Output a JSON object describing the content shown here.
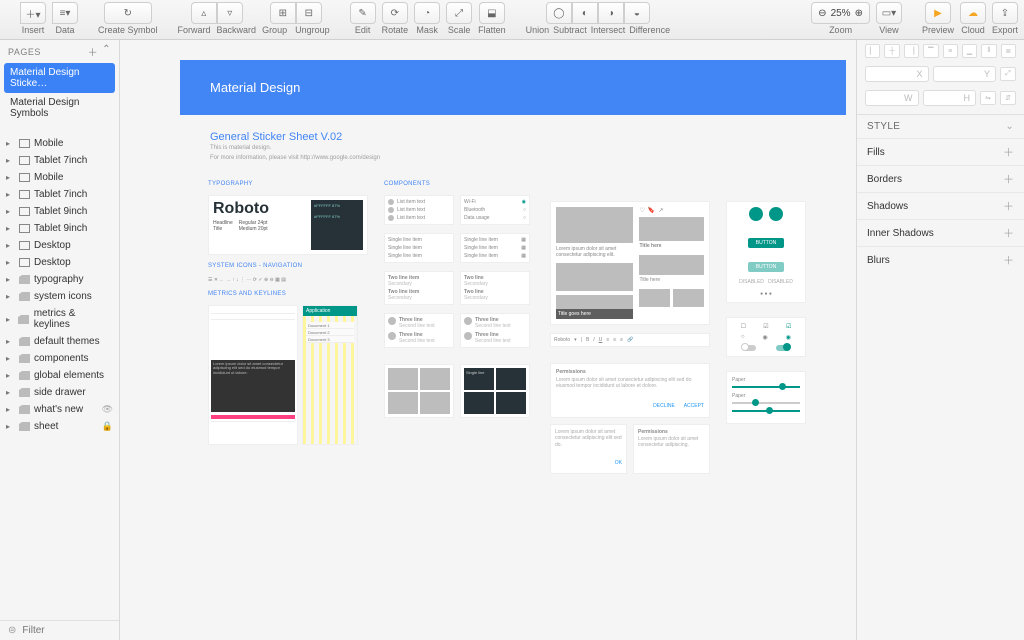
{
  "toolbar": {
    "insert": "Insert",
    "data": "Data",
    "create_symbol": "Create Symbol",
    "forward": "Forward",
    "backward": "Backward",
    "group": "Group",
    "ungroup": "Ungroup",
    "edit": "Edit",
    "rotate": "Rotate",
    "mask": "Mask",
    "scale": "Scale",
    "flatten": "Flatten",
    "union": "Union",
    "subtract": "Subtract",
    "intersect": "Intersect",
    "difference": "Difference",
    "zoom": "Zoom",
    "zoom_value": "25%",
    "view": "View",
    "preview": "Preview",
    "cloud": "Cloud",
    "export": "Export"
  },
  "left": {
    "pages_label": "PAGES",
    "pages": [
      "Material Design Sticke…",
      "Material Design Symbols"
    ],
    "layers": [
      {
        "label": "Mobile",
        "kind": "artboard"
      },
      {
        "label": "Tablet 7inch",
        "kind": "artboard"
      },
      {
        "label": "Mobile",
        "kind": "artboard"
      },
      {
        "label": "Tablet 7inch",
        "kind": "artboard"
      },
      {
        "label": "Tablet 9inch",
        "kind": "artboard"
      },
      {
        "label": "Tablet 9inch",
        "kind": "artboard"
      },
      {
        "label": "Desktop",
        "kind": "artboard"
      },
      {
        "label": "Desktop",
        "kind": "artboard"
      },
      {
        "label": "typography",
        "kind": "folder"
      },
      {
        "label": "system icons",
        "kind": "folder"
      },
      {
        "label": "metrics & keylines",
        "kind": "folder"
      },
      {
        "label": "default themes",
        "kind": "folder"
      },
      {
        "label": "components",
        "kind": "folder"
      },
      {
        "label": "global elements",
        "kind": "folder"
      },
      {
        "label": "side drawer",
        "kind": "folder"
      },
      {
        "label": "what's new",
        "kind": "folder",
        "hidden": true
      },
      {
        "label": "sheet",
        "kind": "folder",
        "locked": true
      }
    ],
    "filter_placeholder": "Filter"
  },
  "canvas": {
    "header_title": "Material Design",
    "sheet_title": "General Sticker Sheet V.02",
    "sheet_desc1": "This is material design.",
    "sheet_desc2": "For more information, please visit http://www.google.com/design",
    "section_typography": "TYPOGRAPHY",
    "section_components": "COMPONENTS",
    "roboto": "Roboto",
    "headline": "Headline",
    "title": "Title",
    "regular_24": "Regular 24pt",
    "medium_20": "Medium 20pt",
    "system_icons": "SYSTEM ICONS - NAVIGATION",
    "metrics": "METRICS AND KEYLINES",
    "application": "Application",
    "title_goes_here": "Title goes here",
    "title_here": "Title here",
    "permissions": "Permissions"
  },
  "inspector": {
    "x": "X",
    "y": "Y",
    "w": "W",
    "h": "H",
    "style": "STYLE",
    "sections": [
      "Fills",
      "Borders",
      "Shadows",
      "Inner Shadows",
      "Blurs"
    ]
  }
}
